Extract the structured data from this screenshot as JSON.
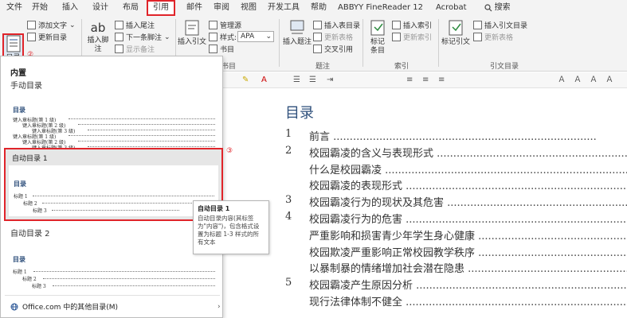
{
  "menubar": {
    "tabs": [
      "文件",
      "开始",
      "插入",
      "设计",
      "布局",
      "引用",
      "邮件",
      "审阅",
      "视图",
      "开发工具",
      "帮助",
      "ABBYY FineReader 12",
      "Acrobat"
    ],
    "active_tab": "引用",
    "search_label": "搜索",
    "marker_1": "①"
  },
  "ribbon": {
    "toc_label": "目录",
    "marker_2": "②",
    "add_text": "添加文字",
    "update_toc": "更新目录",
    "insert_footnote": "插入脚注",
    "insert_endnote": "插入尾注",
    "next_footnote": "下一条脚注",
    "show_notes": "显示备注",
    "footnote_glyph": "ab",
    "insert_citation": "插入引文",
    "manage_sources": "管理源",
    "style_label": "样式:",
    "style_value": "APA",
    "bibliography": "书目",
    "citations_group": "书目",
    "insert_caption": "插入题注",
    "insert_table_of_figures": "插入表目录",
    "update_table": "更新表格",
    "cross_reference": "交叉引用",
    "captions_group": "题注",
    "mark_entry": "标记条目",
    "insert_index": "插入索引",
    "update_index": "更新索引",
    "index_group": "索引",
    "mark_citation": "标记引文",
    "insert_table_of_authorities": "插入引文目录",
    "update_table_auth": "更新表格",
    "authorities_group": "引文目录"
  },
  "dropdown": {
    "builtin_header": "内置",
    "manual_toc": "手动目录",
    "manual_preview_title": "目录",
    "manual_preview_lines": [
      "键入章标题(第 1 级)",
      "键入章标题(第 2 级)",
      "键入章标题(第 3 级)",
      "键入章标题(第 1 级)",
      "键入章标题(第 2 级)",
      "键入章标题(第 3 级)"
    ],
    "auto_toc_1": "自动目录 1",
    "marker_3": "③",
    "auto1_preview_title": "目录",
    "auto1_preview_lines": [
      "标题 1",
      "标题 2",
      "标题 3"
    ],
    "auto_toc_2": "自动目录 2",
    "auto2_preview_title": "目录",
    "auto2_preview_lines": [
      "标题 1",
      "标题 2",
      "标题 3"
    ],
    "footer_link": "Office.com 中的其他目录(M)"
  },
  "tooltip": {
    "title": "自动目录 1",
    "description": "自动目录内容(其标签为\"内容\")，包含格式设置为标题 1-3 样式的所有文本"
  },
  "document": {
    "title": "目录",
    "entries": [
      {
        "num": "1",
        "text": "前言",
        "level": 1
      },
      {
        "num": "2",
        "text": "校园霸凌的含义与表现形式",
        "level": 1
      },
      {
        "num": "",
        "text": "什么是校园霸凌",
        "level": 2
      },
      {
        "num": "",
        "text": "校园霸凌的表现形式",
        "level": 2
      },
      {
        "num": "3",
        "text": "校园霸凌行为的现状及其危害",
        "level": 1
      },
      {
        "num": "4",
        "text": "校园霸凌行为的危害",
        "level": 1
      },
      {
        "num": "",
        "text": "严重影响和损害青少年学生身心健康",
        "level": 2
      },
      {
        "num": "",
        "text": "校园欺凌严重影响正常校园教学秩序",
        "level": 2
      },
      {
        "num": "",
        "text": "以暴制暴的情绪增加社会潜在隐患",
        "level": 2
      },
      {
        "num": "5",
        "text": "校园霸凌产生原因分析",
        "level": 1
      },
      {
        "num": "",
        "text": "现行法律体制不健全",
        "level": 2
      }
    ]
  },
  "colors": {
    "highlight": "#e0242a",
    "heading": "#2e4f7b",
    "ribbon_bg": "#f3f3f3"
  }
}
